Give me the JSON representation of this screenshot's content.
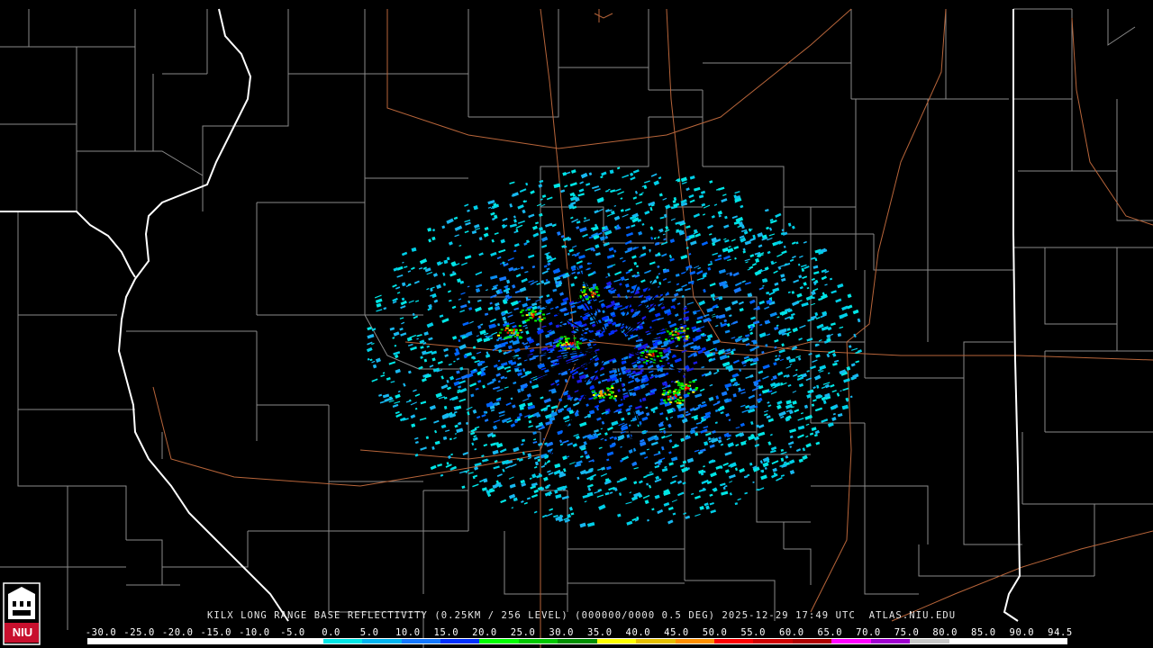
{
  "product": {
    "caption": "KILX LONG RANGE BASE REFLECTIVITY (0.25KM / 256 LEVEL) (000000/0000 0.5 DEG) 2025-12-29 17:49 UTC  ATLAS.NIU.EDU"
  },
  "logo": {
    "text": "NIU",
    "color": "#c8102e"
  },
  "map_layers": {
    "state_boundaries": "#ffffff",
    "county_lines": "#8a8a8a",
    "highways": "#b8653a",
    "background": "#000000"
  },
  "radar_palette": [
    "#00ffff",
    "#00c8ff",
    "#0096ff",
    "#0000ff",
    "#00ff00",
    "#00c800",
    "#009600",
    "#ffff00",
    "#e6b400",
    "#ff9600",
    "#ff0000",
    "#d20000",
    "#b40000",
    "#ff00ff",
    "#9600c8",
    "#ffffff"
  ],
  "colorbar": {
    "labels": [
      "-30.0",
      "-25.0",
      "-20.0",
      "-15.0",
      "-10.0",
      "-5.0",
      "0.0",
      "5.0",
      "10.0",
      "15.0",
      "20.0",
      "25.0",
      "30.0",
      "35.0",
      "40.0",
      "45.0",
      "50.0",
      "55.0",
      "60.0",
      "65.0",
      "70.0",
      "75.0",
      "80.0",
      "85.0",
      "90.0",
      "94.5"
    ],
    "colors": [
      "#ffffff",
      "#ffffff",
      "#ffffff",
      "#ffffff",
      "#ffffff",
      "#ffffff",
      "#00e6e6",
      "#00b4f0",
      "#1478ff",
      "#0030ff",
      "#00ff00",
      "#00c800",
      "#009000",
      "#ffff00",
      "#e6c000",
      "#ff9000",
      "#ff0000",
      "#d00000",
      "#b00000",
      "#ff00ff",
      "#a000d0",
      "#c8c8c8",
      "#ffffff",
      "#ffffff",
      "#ffffff"
    ]
  }
}
